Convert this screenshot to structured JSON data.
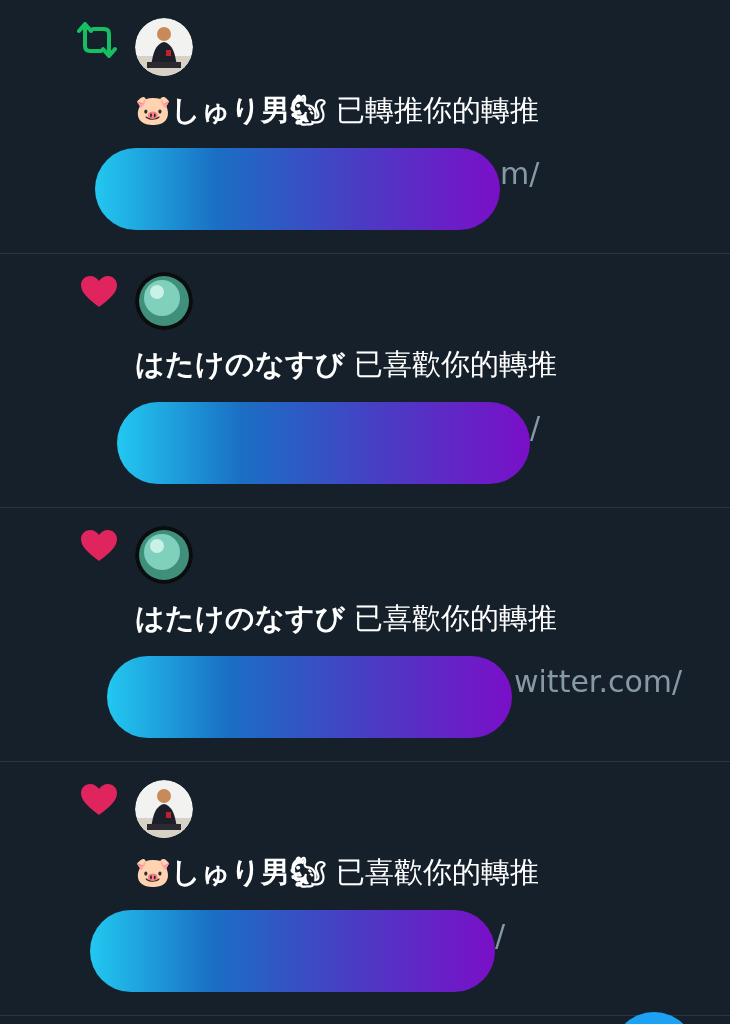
{
  "notifications": [
    {
      "kind": "retweet",
      "text": "**🐷しゅり男🐿** 已轉推你的轉推",
      "link_tail": "m/"
    },
    {
      "kind": "like",
      "text": "**はたけのなすび** 已喜歡你的轉推",
      "link_tail": "/"
    },
    {
      "kind": "like",
      "text": "**はたけのなすび** 已喜歡你的轉推",
      "link_tail": "witter.com/"
    },
    {
      "kind": "like",
      "text": "**🐷しゅり男🐿** 已喜歡你的轉推",
      "link_tail": "/"
    }
  ]
}
